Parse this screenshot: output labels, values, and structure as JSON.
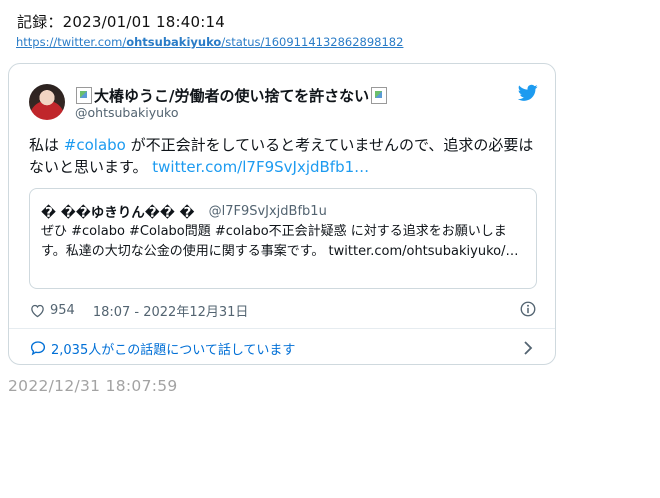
{
  "record": {
    "label": "記録：2023/01/01 18:40:14"
  },
  "source_link": {
    "prefix": "https://twitter.com/",
    "user": "ohtsubakiyuko",
    "suffix": "/status/1609114132862898182"
  },
  "tweet": {
    "display_name": "大椿ゆうこ/労働者の使い捨てを許さない",
    "handle": "@ohtsubakiyuko",
    "text_before": "私は ",
    "hashtag": "#colabo",
    "text_after": " が不正会計をしていると考えていませんので、追求の必要はないと思います。 ",
    "link": "twitter.com/l7F9SvJxjdBfb1…",
    "quote": {
      "name": "� ��ゆきりん�� �",
      "handle": "@l7F9SvJxjdBfb1u",
      "text": "ぜひ #colabo #Colabo問題 #colabo不正会計疑惑 に対する追求をお願いします。私達の大切な公金の使用に関する事案です。 twitter.com/ohtsubakiyuko/…"
    },
    "likes": "954",
    "timestamp": "18:07 - 2022年12月31日",
    "conversation": "2,035人がこの話題について話しています"
  },
  "post_time": "2022/12/31 18:07:59",
  "colors": {
    "link": "#1d9bf0",
    "twitter_blue": "#1d9bf0",
    "muted": "#536471",
    "border": "#cfd9de"
  },
  "icons": [
    "broken-image-icon",
    "twitter-bird-icon",
    "heart-icon",
    "info-icon",
    "speech-bubble-icon",
    "chevron-right-icon"
  ]
}
